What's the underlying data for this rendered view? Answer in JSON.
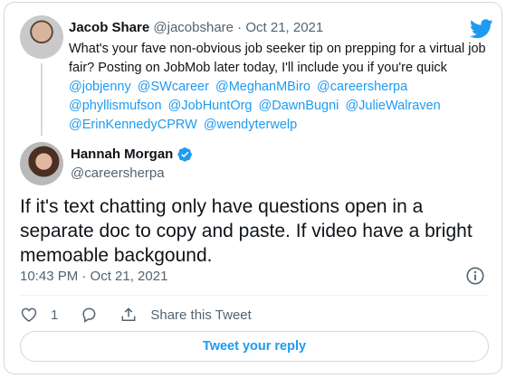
{
  "parent_tweet": {
    "name": "Jacob Share",
    "handle": "@jacobshare",
    "separator": "·",
    "date": "Oct 21, 2021",
    "text": "What's your fave non-obvious job seeker tip on prepping for a virtual job fair? Posting on JobMob later today, I'll include you if you're quick",
    "mentions": [
      "@jobjenny",
      "@SWcareer",
      "@MeghanMBiro",
      "@careersherpa",
      "@phyllismufson",
      "@JobHuntOrg",
      "@DawnBugni",
      "@JulieWalraven",
      "@ErinKennedyCPRW",
      "@wendyterwelp"
    ]
  },
  "reply_tweet": {
    "name": "Hannah Morgan",
    "handle": "@careersherpa",
    "text": "If it's text chatting only have questions open in a separate doc to copy and paste. If video have a bright memoable backgound.",
    "timestamp": "10:43 PM · Oct 21, 2021"
  },
  "actions": {
    "like_count": "1",
    "share_label": "Share this Tweet"
  },
  "reply_button_label": "Tweet your reply",
  "colors": {
    "accent": "#1d9bf0",
    "text": "#0f1419",
    "muted": "#536471",
    "border": "#cfd9de",
    "like": "#536471"
  },
  "icons": [
    "twitter-logo",
    "verified-badge",
    "info-icon",
    "heart-icon",
    "reply-bubble-icon",
    "share-icon"
  ]
}
